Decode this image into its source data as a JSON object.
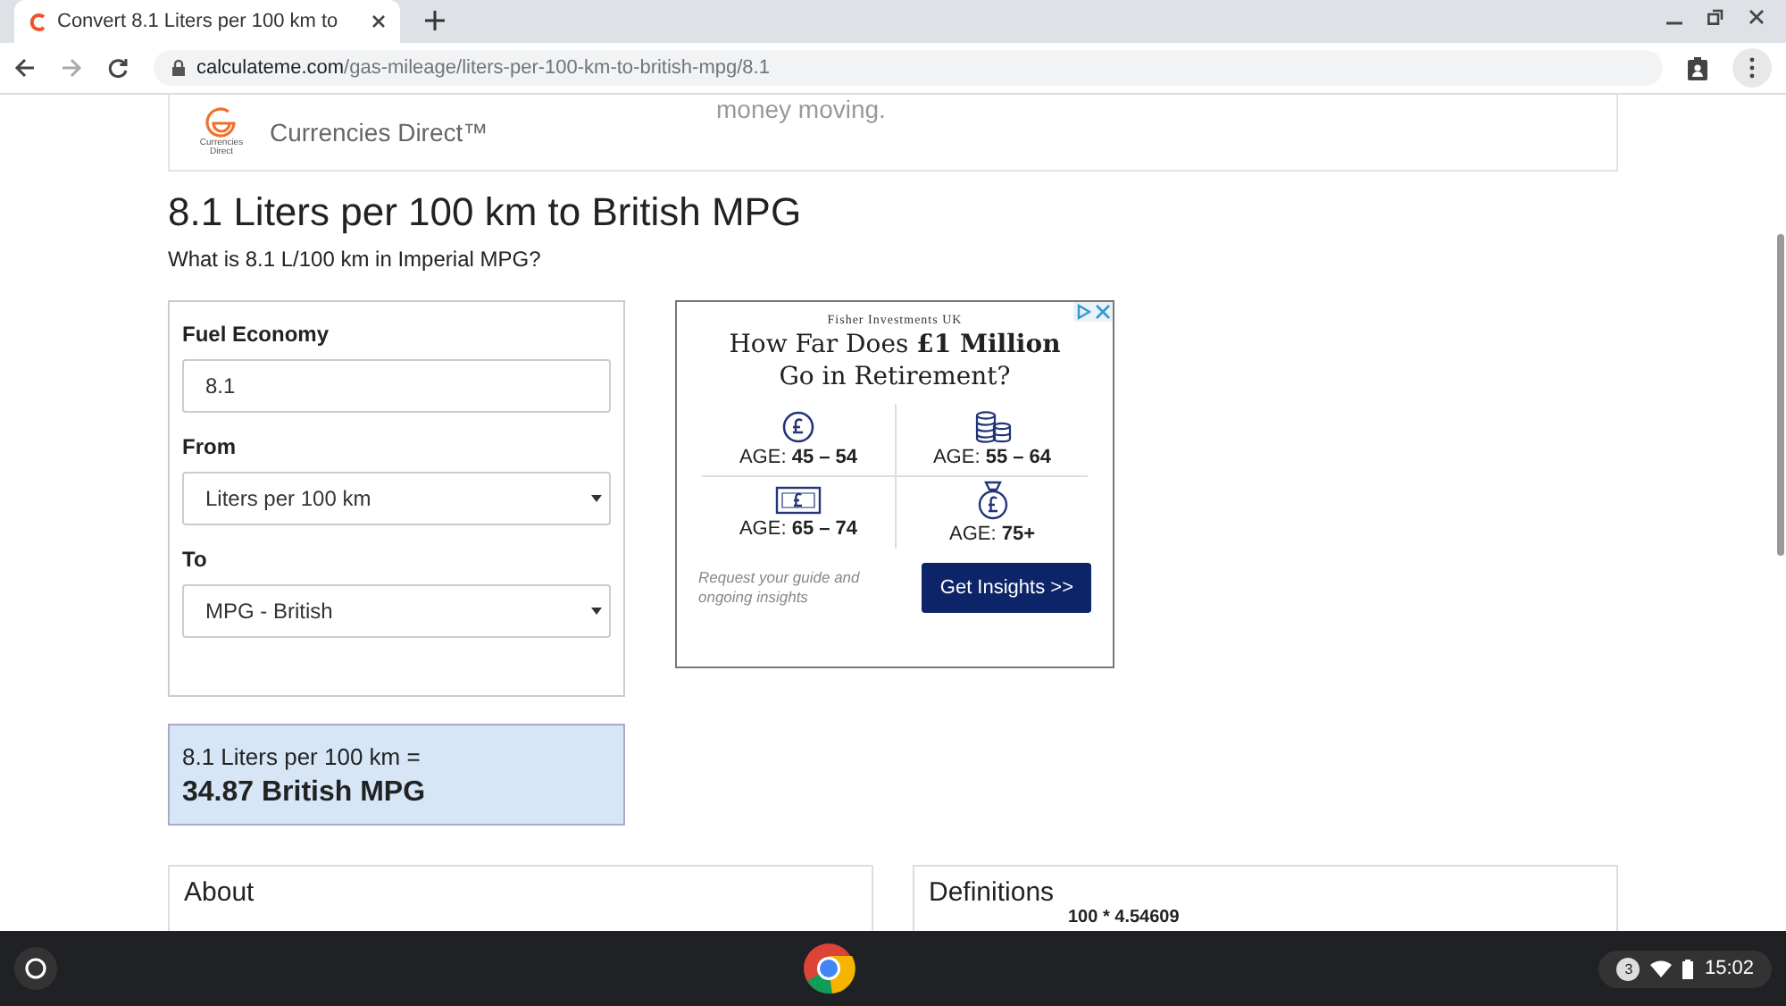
{
  "browser": {
    "tab_title": "Convert 8.1 Liters per 100 km to",
    "url_host": "calculateme.com",
    "url_path": "/gas-mileage/liters-per-100-km-to-british-mpg/8.1"
  },
  "banner": {
    "logo_caption": "Currencies Direct",
    "name": "Currencies Direct™",
    "tagline": "money moving."
  },
  "page": {
    "title": "8.1 Liters per 100 km to British MPG",
    "subtitle": "What is 8.1 L/100 km in Imperial MPG?"
  },
  "form": {
    "fields": [
      {
        "kind": "input",
        "label": "Fuel Economy",
        "value": "8.1"
      },
      {
        "kind": "select",
        "label": "From",
        "value": "Liters per 100 km"
      },
      {
        "kind": "select",
        "label": "To",
        "value": "MPG - British"
      }
    ]
  },
  "result": {
    "line": "8.1 Liters per 100 km =",
    "answer": "34.87 British MPG"
  },
  "ad": {
    "brand": "Fisher Investments UK",
    "headline": "How Far Does **£1 Million** Go in Retirement?",
    "cells": [
      {
        "kind": "coin",
        "prefix": "AGE:",
        "range": "45 – 54"
      },
      {
        "kind": "stack",
        "prefix": "AGE:",
        "range": "55 – 64"
      },
      {
        "kind": "note",
        "prefix": "AGE:",
        "range": "65 – 74"
      },
      {
        "kind": "bag",
        "prefix": "AGE:",
        "range": "75+"
      }
    ],
    "footnote": "Request your guide and ongoing insights",
    "button": "Get Insights >>"
  },
  "cards": [
    {
      "title": "About"
    },
    {
      "title": "Definitions",
      "snippet": "100 * 4.54609"
    }
  ],
  "taskbar": {
    "notifications": "3",
    "time": "15:02"
  }
}
